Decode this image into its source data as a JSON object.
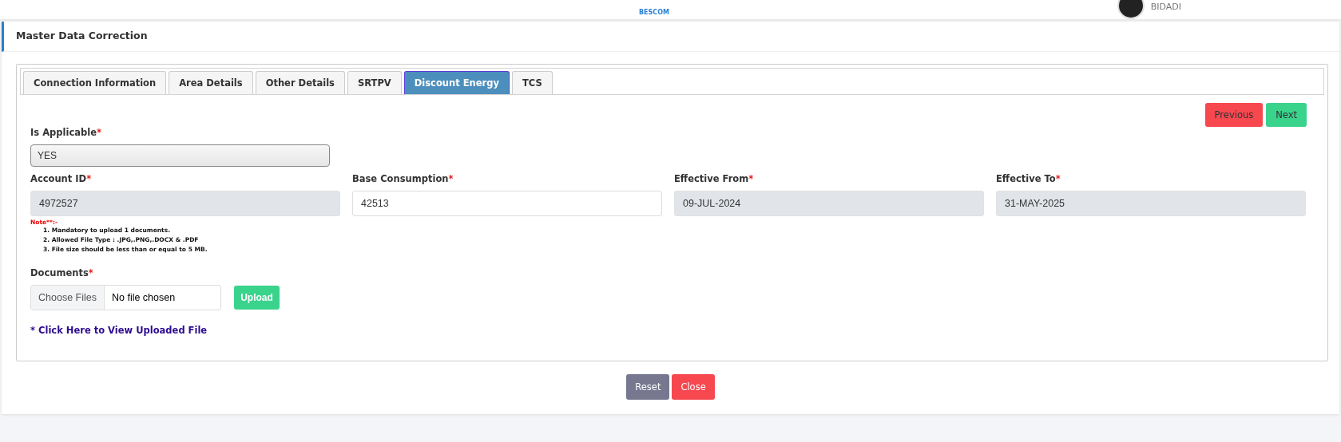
{
  "header": {
    "logo_text": "BESCOM",
    "user_location": "BIDADI"
  },
  "page": {
    "title": "Master Data Correction"
  },
  "tabs": [
    {
      "label": "Connection Information",
      "selected": false
    },
    {
      "label": "Area Details",
      "selected": false
    },
    {
      "label": "Other Details",
      "selected": false
    },
    {
      "label": "SRTPV",
      "selected": false
    },
    {
      "label": "Discount Energy",
      "selected": true
    },
    {
      "label": "TCS",
      "selected": false
    }
  ],
  "nav_buttons": [
    {
      "label": "Previous",
      "kind": "danger"
    },
    {
      "label": "Next",
      "kind": "success"
    }
  ],
  "is_applicable": {
    "label": "Is Applicable",
    "required": "*",
    "value": "YES"
  },
  "fields": [
    {
      "label": "Account ID",
      "required": "*",
      "value": "4972527",
      "disabled": true
    },
    {
      "label": "Base Consumption",
      "required": "*",
      "value": "42513",
      "disabled": false
    },
    {
      "label": "Effective From",
      "required": "*",
      "value": "09-JUL-2024",
      "disabled": true
    },
    {
      "label": "Effective To",
      "required": "*",
      "value": "31-MAY-2025",
      "disabled": true
    }
  ],
  "note": {
    "title": "Note**:-",
    "items": [
      "1. Mandatory to upload 1 documents.",
      "2. Allowed File Type : .JPG,.PNG,.DOCX & .PDF",
      "3. File size should be less than or equal to 5 MB."
    ]
  },
  "documents": {
    "label": "Documents",
    "required": "*",
    "choose_button": "Choose Files",
    "file_status": "No file chosen",
    "upload_button": "Upload"
  },
  "view_link": "* Click Here to View Uploaded File",
  "footer_buttons": [
    {
      "label": "Reset",
      "kind": "secondary"
    },
    {
      "label": "Close",
      "kind": "danger"
    }
  ]
}
